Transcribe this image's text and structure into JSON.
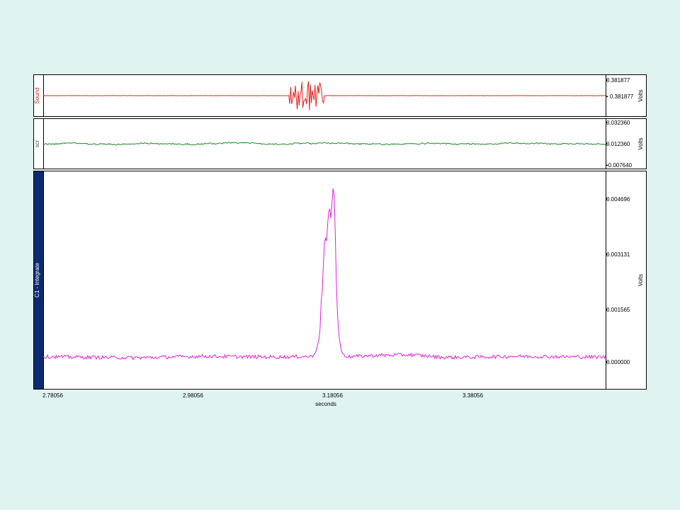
{
  "chart_data": {
    "type": "line",
    "xlabel": "seconds",
    "x_ticks": [
      "2.78056",
      "2.98056",
      "3.18056",
      "3.38056"
    ],
    "xlim": [
      2.7706,
      3.5826
    ],
    "channels": [
      {
        "name": "Sound",
        "unit": "Volts",
        "color": "#e8221a",
        "label_color": "#cc2222",
        "ylim": [
          -0.381877,
          0.381877
        ],
        "y_ticks": [
          "0.381877",
          "- 0.381877"
        ],
        "baseline": 0,
        "burst": {
          "start": 3.1264,
          "end": 3.1763,
          "amplitude": 0.27
        }
      },
      {
        "name": "scr",
        "unit": "Volts",
        "color": "#1d8a2b",
        "label_color": "#555555",
        "ylim": [
          -0.00764,
          0.03236
        ],
        "y_ticks": [
          "0.032360",
          "0.012360",
          "-0.007640"
        ],
        "baseline": 0.01236
      },
      {
        "name": "C1 - Integrate",
        "unit": "Volts",
        "color": "#dd22dd",
        "label_color": "#ffffff",
        "ylim": [
          -0.00082,
          0.00483
        ],
        "y_ticks": [
          "0.004696",
          "0.003131",
          "0.001565",
          "0.000000"
        ],
        "points": [
          [
            2.7706,
            3e-05
          ],
          [
            2.9,
            0.0
          ],
          [
            3.0,
            4e-05
          ],
          [
            3.1,
            2e-05
          ],
          [
            3.14,
            3e-05
          ],
          [
            3.16,
            4e-05
          ],
          [
            3.165,
            0.00018
          ],
          [
            3.17,
            0.0006
          ],
          [
            3.172,
            0.0015
          ],
          [
            3.174,
            0.0018
          ],
          [
            3.176,
            0.0029
          ],
          [
            3.178,
            0.0031
          ],
          [
            3.18,
            0.003
          ],
          [
            3.182,
            0.0037
          ],
          [
            3.184,
            0.0039
          ],
          [
            3.186,
            0.0036
          ],
          [
            3.188,
            0.0041
          ],
          [
            3.19,
            0.0046
          ],
          [
            3.192,
            0.0034
          ],
          [
            3.194,
            0.0018
          ],
          [
            3.196,
            0.0009
          ],
          [
            3.198,
            0.0005
          ],
          [
            3.2,
            0.0003
          ],
          [
            3.202,
            0.00012
          ],
          [
            3.21,
            3e-05
          ],
          [
            3.25,
            6e-05
          ],
          [
            3.3,
            8e-05
          ],
          [
            3.35,
            1e-05
          ],
          [
            3.4,
            2e-05
          ],
          [
            3.45,
            4e-05
          ],
          [
            3.5,
            3e-05
          ],
          [
            3.5826,
            2e-05
          ]
        ]
      }
    ]
  }
}
